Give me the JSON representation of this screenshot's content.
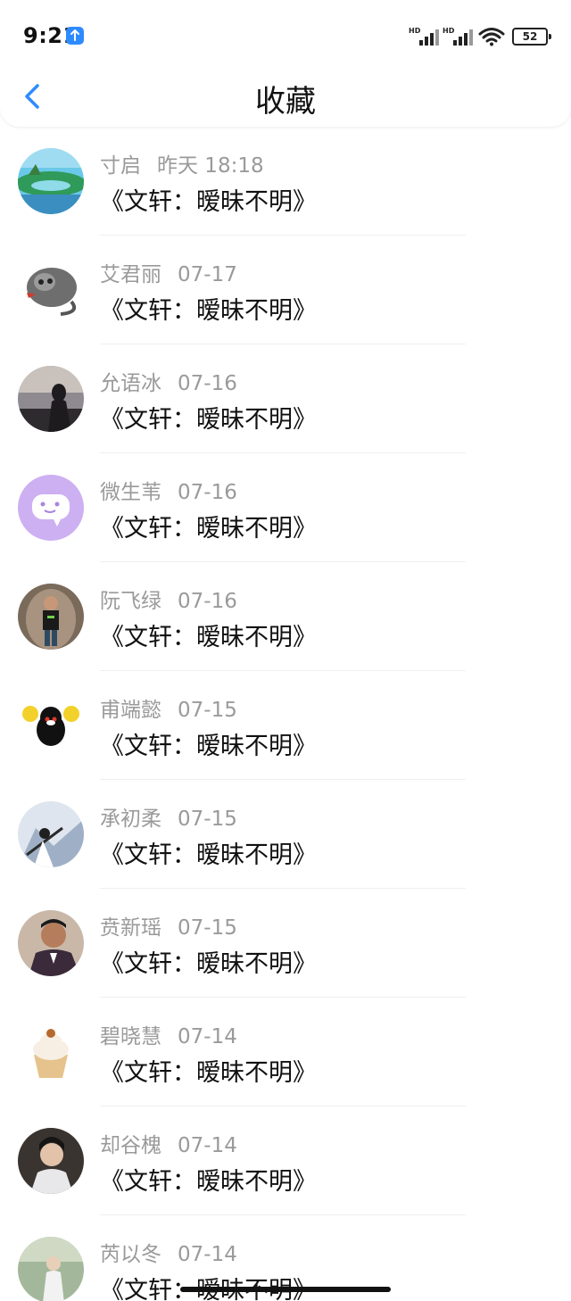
{
  "status_bar": {
    "time": "9:21",
    "battery": "52",
    "network_label": "HD"
  },
  "nav": {
    "title": "收藏"
  },
  "items": [
    {
      "name": "寸启",
      "date": "昨天 18:18",
      "message": "《文轩：暧昧不明》",
      "avatar": "landscape-island-avatar"
    },
    {
      "name": "艾君丽",
      "date": "07-17",
      "message": "《文轩：暧昧不明》",
      "avatar": "cat-sketch-avatar"
    },
    {
      "name": "允语冰",
      "date": "07-16",
      "message": "《文轩：暧昧不明》",
      "avatar": "girl-sunset-avatar"
    },
    {
      "name": "微生苇",
      "date": "07-16",
      "message": "《文轩：暧昧不明》",
      "avatar": "purple-chat-bubble-avatar"
    },
    {
      "name": "阮飞绿",
      "date": "07-16",
      "message": "《文轩：暧昧不明》",
      "avatar": "man-cave-photo-avatar"
    },
    {
      "name": "甫端懿",
      "date": "07-15",
      "message": "《文轩：暧昧不明》",
      "avatar": "kumamon-bear-avatar"
    },
    {
      "name": "承初柔",
      "date": "07-15",
      "message": "《文轩：暧昧不明》",
      "avatar": "anime-swordsman-avatar"
    },
    {
      "name": "贲新瑶",
      "date": "07-15",
      "message": "《文轩：暧昧不明》",
      "avatar": "man-suit-photo-avatar"
    },
    {
      "name": "碧晓慧",
      "date": "07-14",
      "message": "《文轩：暧昧不明》",
      "avatar": "cupcake-avatar"
    },
    {
      "name": "却谷槐",
      "date": "07-14",
      "message": "《文轩：暧昧不明》",
      "avatar": "costume-man-avatar"
    },
    {
      "name": "芮以冬",
      "date": "07-14",
      "message": "《文轩：暧昧不明》",
      "avatar": "outdoor-figure-avatar"
    }
  ],
  "colors": {
    "accent": "#2e8bff",
    "meta_text": "#9a9a9a",
    "primary_text": "#111111"
  }
}
